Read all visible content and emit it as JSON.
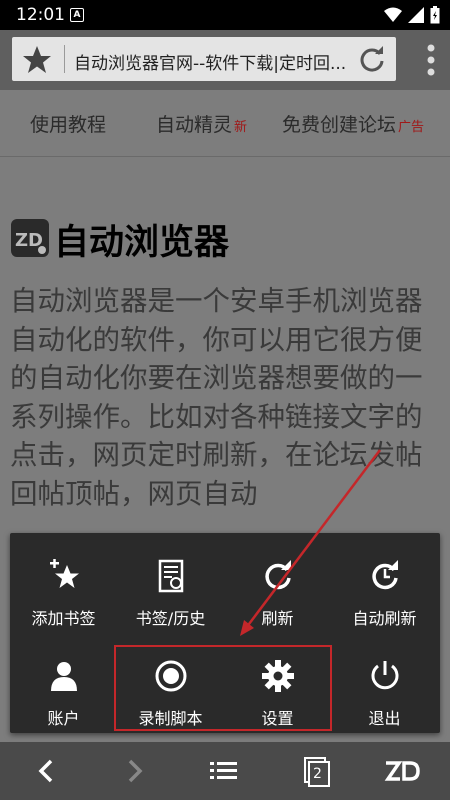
{
  "status": {
    "time": "12:01",
    "badge": "A"
  },
  "toolbar": {
    "url_text": "自动浏览器官网--软件下载|定时回..."
  },
  "nav": {
    "item1": "使用教程",
    "item2": "自动精灵",
    "item2_tag": "新",
    "item3": "免费创建论坛",
    "item3_tag": "广告"
  },
  "page": {
    "title": "自动浏览器",
    "intro": "自动浏览器是一个安卓手机浏览器自动化的软件，你可以用它很方便的自动化你要在浏览器想要做的一系列操作。比如对各种链接文字的点击，网页定时刷新，在论坛发帖回帖顶帖，网页自动"
  },
  "menu": {
    "add_bookmark": "添加书签",
    "bookmarks_history": "书签/历史",
    "refresh": "刷新",
    "auto_refresh": "自动刷新",
    "account": "账户",
    "record_script": "录制脚本",
    "settings": "设置",
    "exit": "退出"
  },
  "bottom": {
    "tab_count": "2"
  },
  "colors": {
    "highlight": "#c4272a",
    "popup_bg": "#2a2a2a",
    "page_bg": "#7d7d7d"
  },
  "icons": [
    "star-icon",
    "refresh-icon",
    "more-vert-icon",
    "add-star-icon",
    "bookmarks-history-icon",
    "refresh-icon",
    "auto-refresh-icon",
    "account-icon",
    "record-icon",
    "settings-gear-icon",
    "power-icon",
    "back-icon",
    "forward-icon",
    "list-icon",
    "tabs-icon",
    "zd-logo-icon"
  ]
}
